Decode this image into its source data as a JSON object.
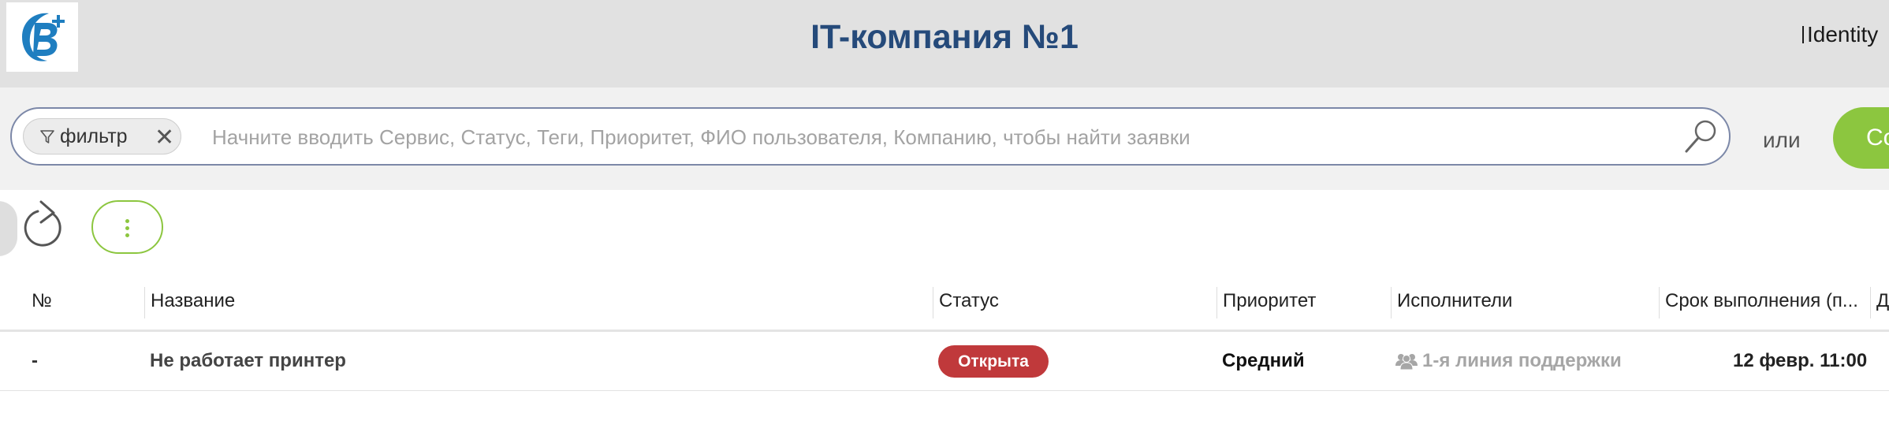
{
  "header": {
    "title": "IT-компания №1",
    "identity_label": "Identity",
    "background_color": "#e1e1e1",
    "title_color": "#254a7a"
  },
  "search": {
    "filter_chip_label": "фильтр",
    "filter_chip_icon": "funnel-icon",
    "filter_chip_close": "✕",
    "placeholder": "Начните вводить Сервис, Статус, Теги, Приоритет, ФИО пользователя, Компанию, чтобы найти заявки",
    "value": "",
    "or_text": "или",
    "create_button_label": "Со",
    "accent_color": "#8cc63f"
  },
  "toolbar": {
    "refresh_icon": "refresh-icon",
    "more_icon": "kebab-menu-icon"
  },
  "table": {
    "columns": [
      "№",
      "Название",
      "Статус",
      "Приоритет",
      "Исполнители",
      "Срок выполнения (п...",
      "Д"
    ],
    "rows": [
      {
        "number": "-",
        "name": "Не работает принтер",
        "status": "Открыта",
        "status_color": "#c0393b",
        "priority": "Средний",
        "assignee": "1-я линия поддержки",
        "assignee_icon": "users-icon",
        "due": "12 февр. 11:00"
      }
    ]
  }
}
